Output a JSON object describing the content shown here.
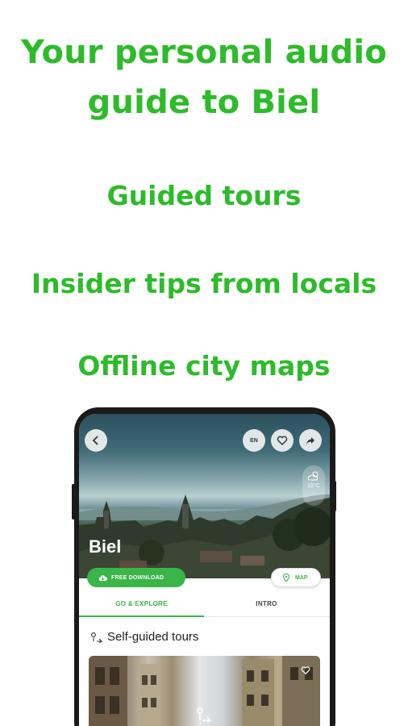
{
  "promo": {
    "title_line1": "Your personal audio",
    "title_line2": "guide to Biel",
    "feature_1": "Guided tours",
    "feature_2": "Insider tips from locals",
    "feature_3": "Offline city maps"
  },
  "app": {
    "city_name": "Biel",
    "language_badge": "EN",
    "weather": {
      "temperature": "15°C",
      "icon": "partly-cloudy-icon"
    },
    "buttons": {
      "download_label": "FREE DOWNLOAD",
      "map_label": "MAP"
    },
    "tabs": [
      {
        "label": "GO & EXPLORE",
        "active": true
      },
      {
        "label": "INTRO",
        "active": false
      }
    ],
    "section_title": "Self-guided tours"
  },
  "colors": {
    "headline_green": "#2dbb2a",
    "accent_green": "#3ab548"
  }
}
